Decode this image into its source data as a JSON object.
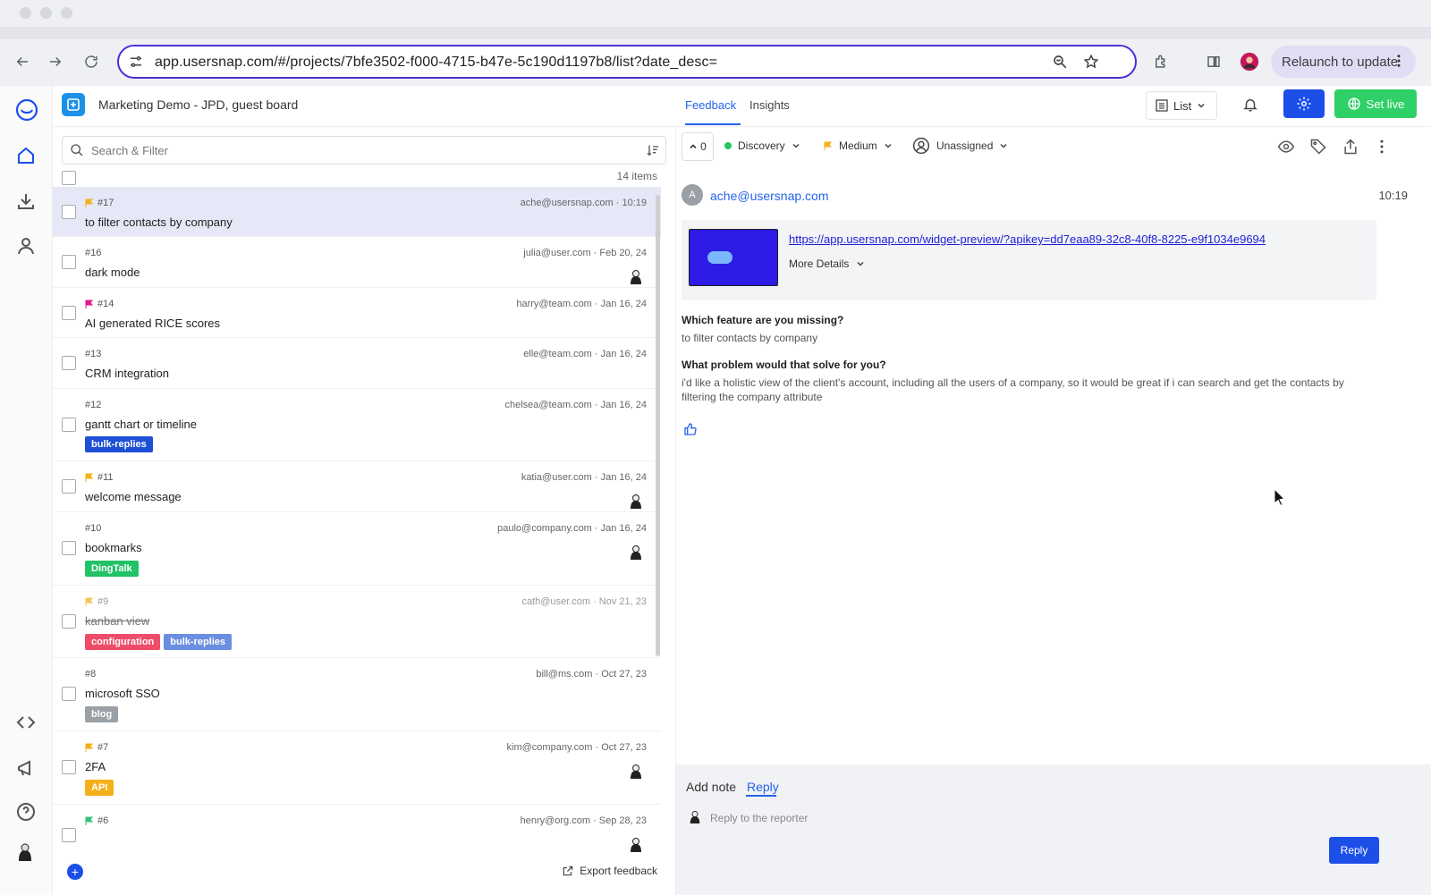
{
  "browser": {
    "url": "app.usersnap.com/#/projects/7bfe3502-f000-4715-b47e-5c190d1197b8/list?date_desc=",
    "relaunch_label": "Relaunch to update"
  },
  "header": {
    "board_title": "Marketing Demo - JPD, guest board",
    "tabs": [
      {
        "label": "Feedback"
      },
      {
        "label": "Insights"
      }
    ],
    "view_label": "List",
    "set_live_label": "Set live"
  },
  "list": {
    "search_placeholder": "Search & Filter",
    "items_count": "14 items",
    "rows": [
      {
        "num": "#17",
        "title": "to filter contacts by company",
        "meta": "ache@usersnap.com · 10:19",
        "flag": "#f5b019",
        "tags": []
      },
      {
        "num": "#16",
        "title": "dark mode",
        "meta": "julia@user.com · Feb 20, 24",
        "flag": "",
        "tags": []
      },
      {
        "num": "#14",
        "title": "AI generated RICE scores",
        "meta": "harry@team.com · Jan 16, 24",
        "flag": "#e6168c",
        "tags": []
      },
      {
        "num": "#13",
        "title": "CRM integration",
        "meta": "elle@team.com · Jan 16, 24",
        "flag": "",
        "tags": []
      },
      {
        "num": "#12",
        "title": "gantt chart or timeline",
        "meta": "chelsea@team.com · Jan 16, 24",
        "flag": "",
        "tags": [
          {
            "label": "bulk-replies",
            "color": "#1e50d6"
          }
        ]
      },
      {
        "num": "#11",
        "title": "welcome message",
        "meta": "katia@user.com · Jan 16, 24",
        "flag": "#f5b019",
        "tags": []
      },
      {
        "num": "#10",
        "title": "bookmarks",
        "meta": "paulo@company.com · Jan 16, 24",
        "flag": "",
        "tags": [
          {
            "label": "DingTalk",
            "color": "#22c266"
          }
        ]
      },
      {
        "num": "#9",
        "title": "kanban view",
        "meta": "cath@user.com · Nov 21, 23",
        "flag": "#f5c65a",
        "tags": [
          {
            "label": "configuration",
            "color": "#ee4c68"
          },
          {
            "label": "bulk-replies",
            "color": "#6a8fe0"
          }
        ]
      },
      {
        "num": "#8",
        "title": "microsoft SSO",
        "meta": "bill@ms.com · Oct 27, 23",
        "flag": "",
        "tags": [
          {
            "label": "blog",
            "color": "#9aa0a6"
          }
        ]
      },
      {
        "num": "#7",
        "title": "2FA",
        "meta": "kim@company.com · Oct 27, 23",
        "flag": "#f5b019",
        "tags": [
          {
            "label": "API",
            "color": "#f5b019"
          }
        ]
      },
      {
        "num": "#6",
        "title": "",
        "meta": "henry@org.com · Sep 28, 23",
        "flag": "#2fc47a",
        "tags": []
      }
    ],
    "export_label": "Export feedback"
  },
  "detail": {
    "vote_count": "0",
    "status_label": "Discovery",
    "priority_label": "Medium",
    "assignee_label": "Unassigned",
    "reporter_initial": "A",
    "reporter_email": "ache@usersnap.com",
    "time": "10:19",
    "preview_link": "https://app.usersnap.com/widget-preview/?apikey=dd7eaa89-32c8-40f8-8225-e9f1034e9694",
    "more_details_label": "More Details",
    "q1": "Which feature are you missing?",
    "a1": "to filter contacts by company",
    "q2": "What problem would that solve for you?",
    "a2": "i'd like a holistic view of the client's account, including all the users of a company, so it would be great if i can search and get the contacts by filtering the company attribute"
  },
  "reply": {
    "tab_note": "Add note",
    "tab_reply": "Reply",
    "placeholder": "Reply to the reporter",
    "button_label": "Reply"
  },
  "colors": {
    "accent": "#1b4fe8",
    "live": "#2fd067",
    "selected_row": "#e6e8f7"
  }
}
